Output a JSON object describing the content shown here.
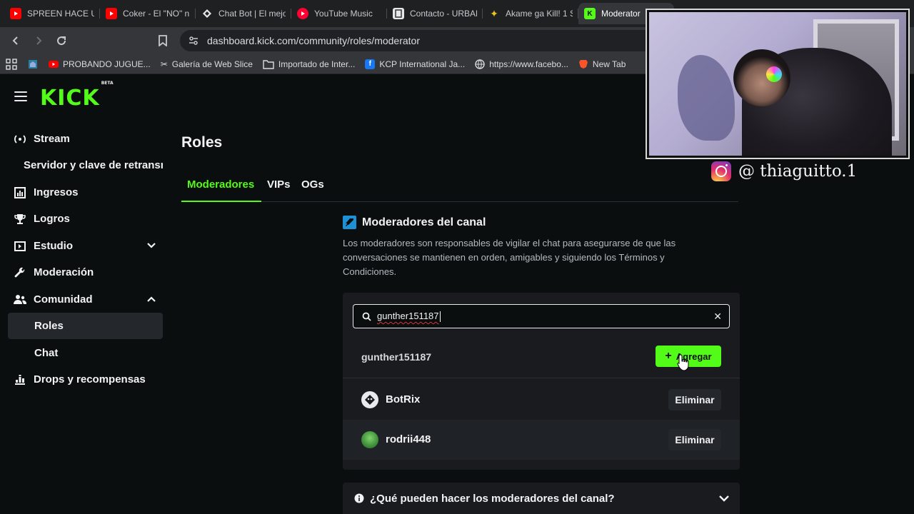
{
  "browser": {
    "tabs": [
      {
        "label": "SPREEN HACE UN",
        "icon": "youtube-icon",
        "color": "#ff0000"
      },
      {
        "label": "Coker - El \"NO\" n",
        "icon": "youtube-icon",
        "color": "#ff0000"
      },
      {
        "label": "Chat Bot | El mejo",
        "icon": "diamond-icon",
        "color": "#ffffff"
      },
      {
        "label": "YouTube Music",
        "icon": "youtube-music-icon",
        "color": "#ff0033"
      },
      {
        "label": "Contacto - URBAN",
        "icon": "page-icon",
        "color": "#e8e8e8"
      },
      {
        "label": "Akame ga Kill! 1 S",
        "icon": "star-icon",
        "color": "#f0c020"
      },
      {
        "label": "Moderator",
        "icon": "kick-icon",
        "color": "#53fc18"
      }
    ],
    "address": "dashboard.kick.com/community/roles/moderator",
    "bookmarks": [
      {
        "label": "PROBANDO JUGUE...",
        "icon": "youtube-icon"
      },
      {
        "label": "Galería de Web Slice",
        "icon": "slice-icon"
      },
      {
        "label": "Importado de Inter...",
        "icon": "folder-icon"
      },
      {
        "label": "KCP International Ja...",
        "icon": "facebook-icon"
      },
      {
        "label": "https://www.facebo...",
        "icon": "globe-icon"
      },
      {
        "label": "New Tab",
        "icon": "brave-icon"
      }
    ]
  },
  "sidebar": {
    "logo": "KICK",
    "logo_badge": "BETA",
    "items": [
      {
        "label": "Stream",
        "icon": "stream-icon"
      },
      {
        "label": "Servidor y clave de retransm",
        "icon": ""
      },
      {
        "label": "Ingresos",
        "icon": "chart-icon"
      },
      {
        "label": "Logros",
        "icon": "trophy-icon"
      },
      {
        "label": "Estudio",
        "icon": "studio-icon"
      },
      {
        "label": "Moderación",
        "icon": "wrench-icon"
      },
      {
        "label": "Comunidad",
        "icon": "users-icon"
      },
      {
        "label": "Roles",
        "icon": ""
      },
      {
        "label": "Chat",
        "icon": ""
      },
      {
        "label": "Drops y recompensas",
        "icon": "drops-icon"
      }
    ]
  },
  "main": {
    "title": "Roles",
    "tabs": [
      "Moderadores",
      "VIPs",
      "OGs"
    ],
    "section_title": "Moderadores del canal",
    "section_desc": "Los moderadores son responsables de vigilar el chat para asegurarse de que las conversaciones se mantienen en orden, amigables y siguiendo los Términos y Condiciones.",
    "search_value": "gunther151187",
    "result_name": "gunther151187",
    "add_label": "Agregar",
    "moderators": [
      {
        "name": "BotRix",
        "remove_label": "Eliminar"
      },
      {
        "name": "rodrii448",
        "remove_label": "Eliminar"
      }
    ],
    "faq_label": "¿Qué pueden hacer los moderadores del canal?"
  },
  "overlay": {
    "instagram_handle": "@ thiaguitto.1"
  },
  "colors": {
    "accent": "#53fc18",
    "background": "#0b0e0f",
    "card": "#191b1f"
  }
}
